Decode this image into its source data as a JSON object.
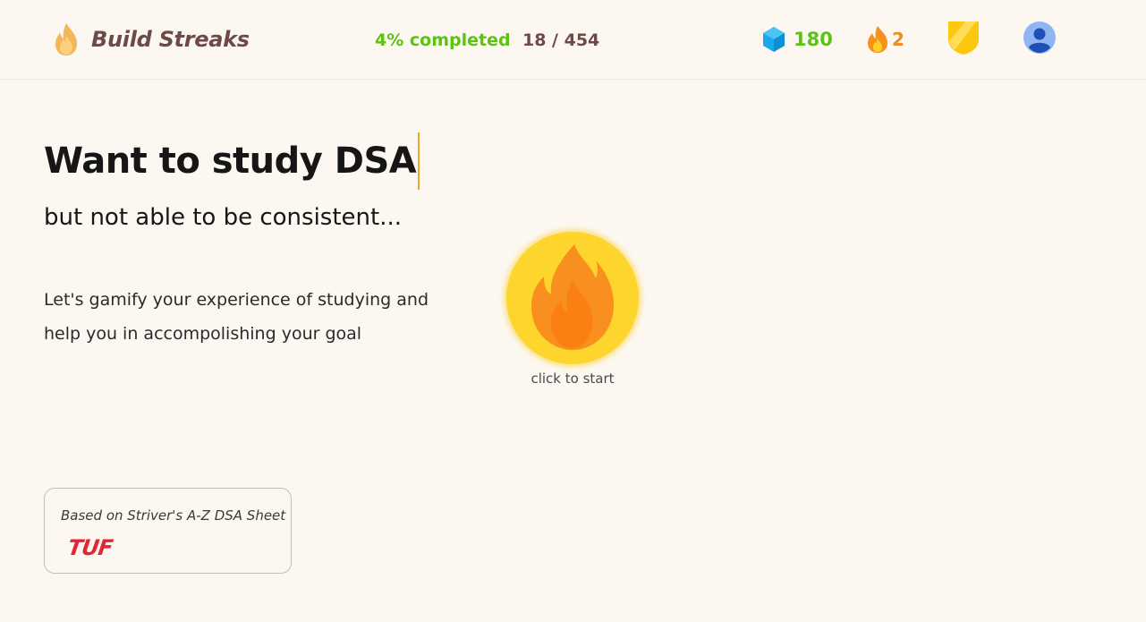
{
  "header": {
    "brand": {
      "title": "Build Streaks",
      "icon": "flame-icon"
    },
    "progress": {
      "completed_label": "4% completed",
      "completed_fraction": 0.04,
      "count_label": "18 / 454"
    },
    "gems": {
      "value": "180",
      "icon": "gem-icon"
    },
    "streak": {
      "value": "2",
      "icon": "streak-flame-icon"
    },
    "badge": {
      "icon": "shield-icon"
    },
    "profile": {
      "icon": "user-avatar-icon"
    }
  },
  "hero": {
    "title": "Want to study DSA",
    "subtitle": "but not able to be consistent...",
    "description": "Let's gamify your experience of studying and help you in accompolishing your goal"
  },
  "start": {
    "icon": "fire-icon",
    "hint": "click to start"
  },
  "source_card": {
    "text": "Based on Striver's A-Z DSA Sheet",
    "logo": "TUF"
  },
  "colors": {
    "background": "#fcf8f1",
    "brand_text": "#6e4a46",
    "progress_green": "#5cc214",
    "streak_orange": "#f08a1c",
    "start_yellow": "#fdd52d",
    "caret": "#f3a72a",
    "tuf_red": "#e52535"
  }
}
